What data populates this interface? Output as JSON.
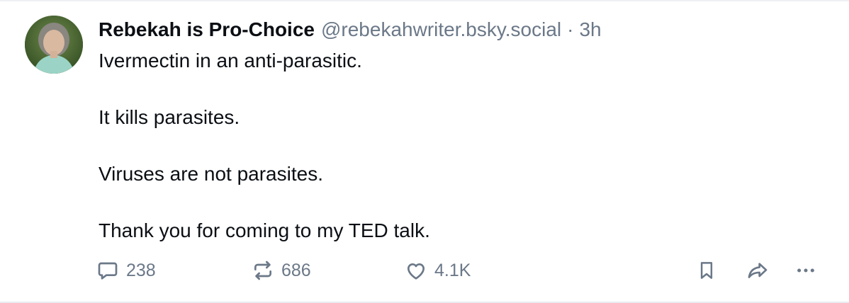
{
  "post": {
    "author": {
      "display_name": "Rebekah is Pro-Choice",
      "handle": "@rebekahwriter.bsky.social",
      "separator": "·",
      "timestamp": "3h"
    },
    "paragraphs": [
      "Ivermectin in an anti-parasitic.",
      "It kills parasites.",
      "Viruses are not parasites.",
      "Thank you for coming to my TED talk."
    ],
    "actions": {
      "reply": {
        "icon": "reply-icon",
        "count": "238"
      },
      "repost": {
        "icon": "repost-icon",
        "count": "686"
      },
      "like": {
        "icon": "heart-icon",
        "count": "4.1K"
      },
      "bookmark": {
        "icon": "bookmark-icon"
      },
      "share": {
        "icon": "share-icon"
      },
      "more": {
        "icon": "more-options-icon"
      }
    }
  },
  "colors": {
    "text_primary": "#0b0f14",
    "text_secondary": "#6b7888",
    "border": "#eef0f3",
    "background": "#ffffff"
  }
}
